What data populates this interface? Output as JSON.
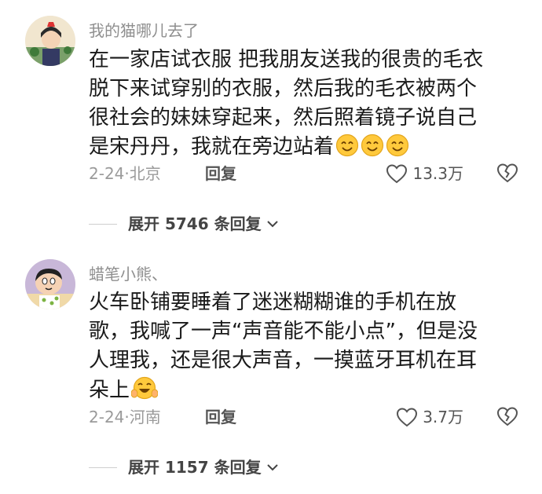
{
  "comments": [
    {
      "username": "我的猫哪儿去了",
      "lines": [
        "在一家店试衣服 把我朋友送我的很贵的毛衣",
        "脱下来试穿别的衣服，然后我的毛衣被两个",
        "很社会的妹妹穿起来，然后照着镜子说自己",
        "是宋丹丹，我就在旁边站着"
      ],
      "trailing_emoji": [
        "smile-emoji",
        "smile-emoji",
        "smile-emoji"
      ],
      "date": "2-24",
      "location": "北京",
      "reply_label": "回复",
      "likes": "13.3万",
      "expand_label": "展开 5746 条回复"
    },
    {
      "username": "蜡笔小熊、",
      "lines": [
        "火车卧铺要睡着了迷迷糊糊谁的手机在放",
        "歌，我喊了一声“声音能不能小点”，但是没",
        "人理我，还是很大声音，一摸蓝牙耳机在耳",
        "朵上"
      ],
      "trailing_emoji": [
        "laugh-emoji"
      ],
      "date": "2-24",
      "location": "河南",
      "reply_label": "回复",
      "likes": "3.7万",
      "expand_label": "展开 1157 条回复"
    }
  ],
  "colors": {
    "username": "#8f8f8f",
    "body_text": "#1a1a1a",
    "meta": "#9a9a9a",
    "emoji_yellow": "#ffc93c"
  }
}
